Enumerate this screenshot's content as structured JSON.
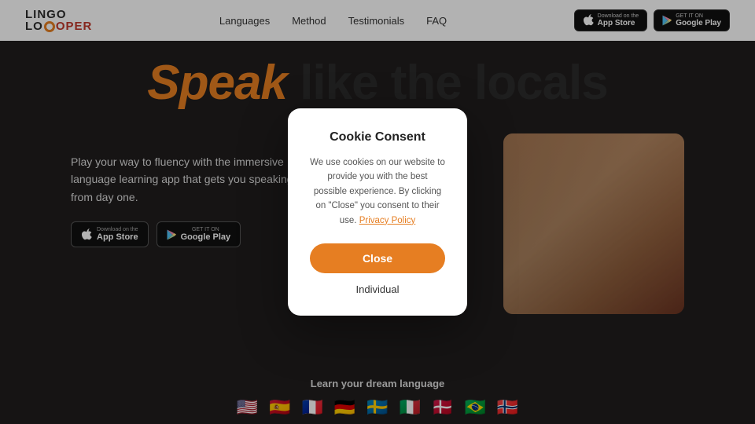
{
  "brand": {
    "name_top": "LINGO",
    "name_bottom_1": "LO",
    "name_bottom_2": "OPER"
  },
  "navbar": {
    "links": [
      {
        "label": "Languages",
        "href": "#"
      },
      {
        "label": "Method",
        "href": "#"
      },
      {
        "label": "Testimonials",
        "href": "#"
      },
      {
        "label": "FAQ",
        "href": "#"
      }
    ],
    "app_store_sub": "Download on the",
    "app_store_main": "App Store",
    "google_play_sub": "GET IT ON",
    "google_play_main": "Google Play"
  },
  "hero": {
    "title_highlight": "Speak",
    "title_rest": " like the locals",
    "description": "Play your way to fluency with the immersive language learning app that gets you speaking from day one.",
    "app_store_sub": "Download on the",
    "app_store_main": "App Store",
    "google_sub": "GET IT ON",
    "google_main": "Google Play"
  },
  "cookie_modal": {
    "title": "Cookie Consent",
    "description_before": "We use cookies on our website to provide you with the best possible experience. By clicking on \"Close\" you consent to their use.",
    "privacy_link_text": "Privacy Policy",
    "close_button": "Close",
    "individual_button": "Individual"
  },
  "footer": {
    "title": "Learn your dream language",
    "flags": [
      "🇺🇸",
      "🇪🇸",
      "🇫🇷",
      "🇩🇪",
      "🇸🇪",
      "🇮🇹",
      "🇩🇰",
      "🇧🇷",
      "🇳🇴"
    ]
  }
}
